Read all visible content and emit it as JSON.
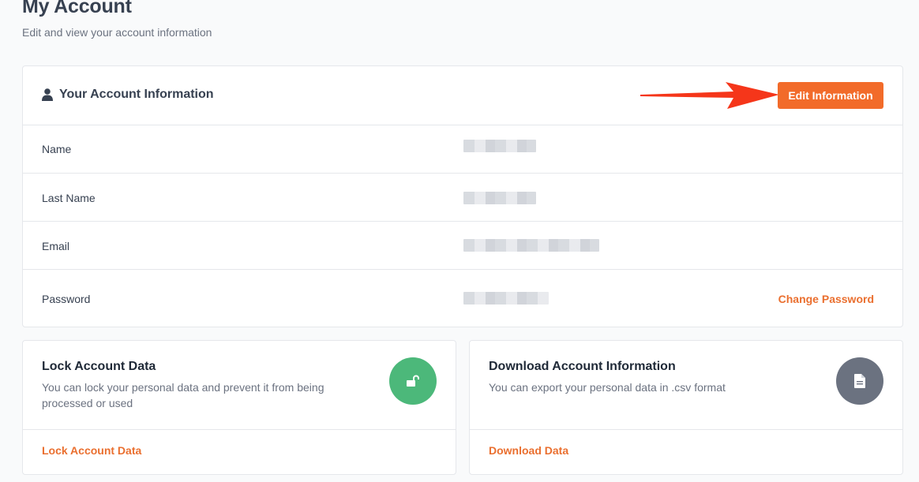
{
  "page": {
    "title": "My Account",
    "subtitle": "Edit and view your account information"
  },
  "account_info": {
    "title": "Your Account Information",
    "edit_button": "Edit Information",
    "rows": [
      {
        "label": "Name"
      },
      {
        "label": "Last Name"
      },
      {
        "label": "Email"
      },
      {
        "label": "Password",
        "action": "Change Password"
      }
    ]
  },
  "lock_card": {
    "title": "Lock Account Data",
    "description": "You can lock your personal data and prevent it from being processed or used",
    "link": "Lock Account Data",
    "icon": "unlock-icon",
    "color": "#4cb87a"
  },
  "download_card": {
    "title": "Download Account Information",
    "description": "You can export your personal data in .csv format",
    "link": "Download Data",
    "icon": "document-icon",
    "color": "#6b7280"
  },
  "colors": {
    "accent": "#f26b2a",
    "arrow": "#f5361a"
  }
}
